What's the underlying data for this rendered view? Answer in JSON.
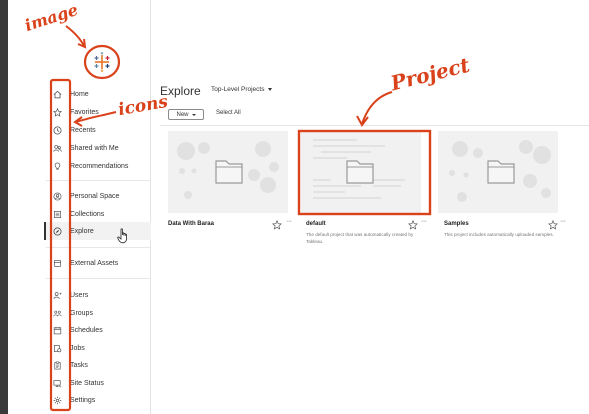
{
  "annotations": {
    "image_label": "image",
    "icons_label": "icons",
    "project_label": "Project"
  },
  "sidebar": {
    "items": [
      {
        "label": "Home",
        "icon": "home-icon"
      },
      {
        "label": "Favorites",
        "icon": "star-icon"
      },
      {
        "label": "Recents",
        "icon": "clock-icon"
      },
      {
        "label": "Shared with Me",
        "icon": "shared-users-icon"
      },
      {
        "label": "Recommendations",
        "icon": "lightbulb-icon"
      },
      {
        "label": "Personal Space",
        "icon": "person-circle-icon"
      },
      {
        "label": "Collections",
        "icon": "collection-icon"
      },
      {
        "label": "Explore",
        "icon": "compass-icon",
        "active": true
      },
      {
        "label": "External Assets",
        "icon": "database-icon"
      },
      {
        "label": "Users",
        "icon": "user-icon"
      },
      {
        "label": "Groups",
        "icon": "group-icon"
      },
      {
        "label": "Schedules",
        "icon": "calendar-icon"
      },
      {
        "label": "Jobs",
        "icon": "jobs-icon"
      },
      {
        "label": "Tasks",
        "icon": "clipboard-icon"
      },
      {
        "label": "Site Status",
        "icon": "monitor-icon"
      },
      {
        "label": "Settings",
        "icon": "gear-icon"
      }
    ]
  },
  "main": {
    "title": "Explore",
    "project_filter": "Top-Level Projects",
    "new_button": "New",
    "select_all": "Select All",
    "cards": [
      {
        "name": "Data With Baraa",
        "description": ""
      },
      {
        "name": "default",
        "description": "The default project that was automatically created by Tableau."
      },
      {
        "name": "Samples",
        "description": "This project includes automatically uploaded samples."
      }
    ],
    "more_glyph": "···"
  },
  "colors": {
    "annotation": "#d9421a",
    "card_bg": "#f1f1f1",
    "accent": "#333333"
  }
}
